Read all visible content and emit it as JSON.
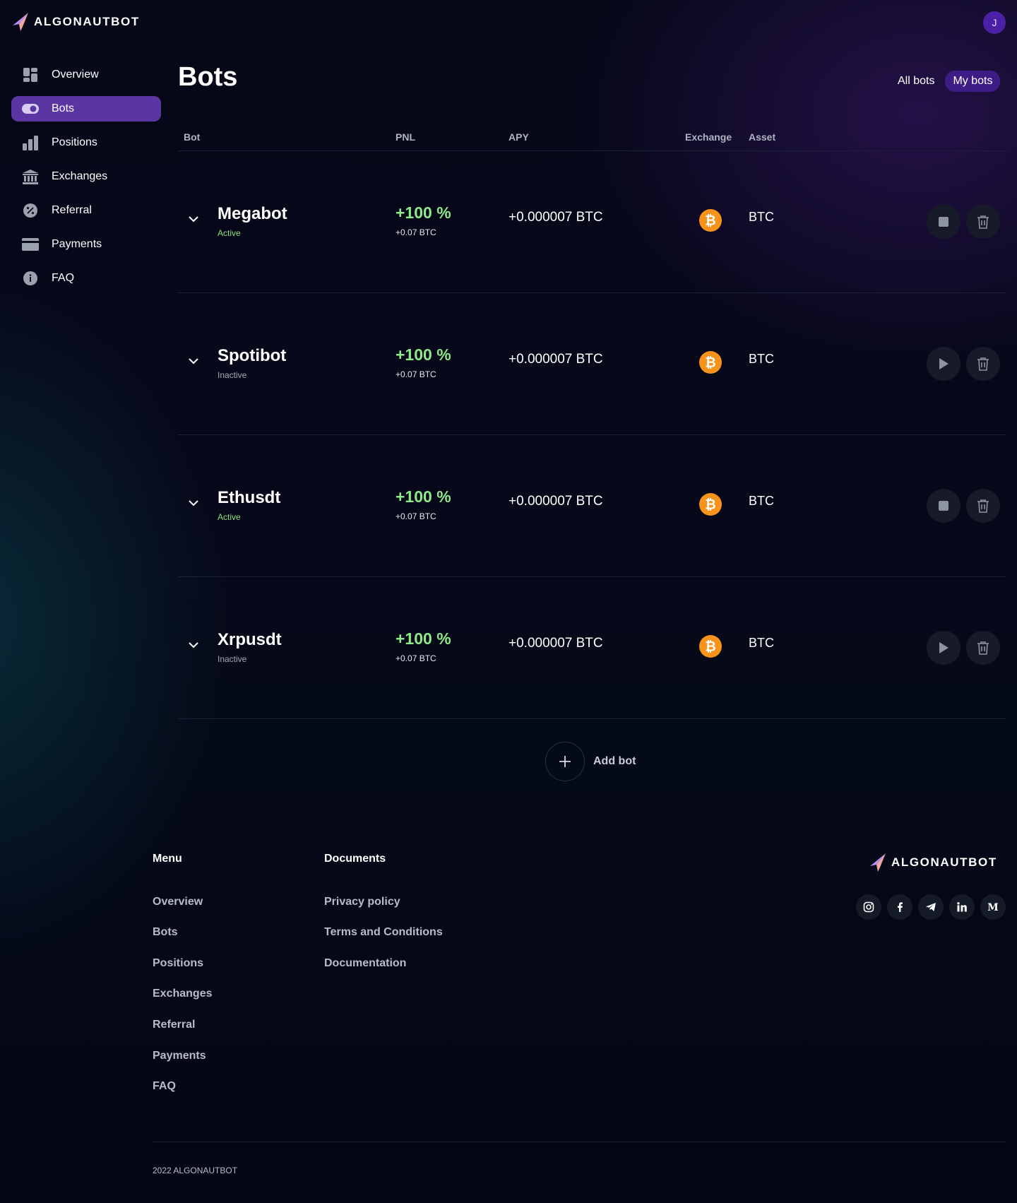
{
  "brand": {
    "name": "ALGONAUTBOT"
  },
  "user": {
    "avatar_initial": "J",
    "avatar_color": "#4b1fa6"
  },
  "colors": {
    "accent": "#5b36a3",
    "positive": "#8fe889",
    "coin": "#f7931a"
  },
  "sidebar": {
    "items": [
      {
        "label": "Overview",
        "icon": "overview-icon"
      },
      {
        "label": "Bots",
        "icon": "toggle-icon",
        "active": true
      },
      {
        "label": "Positions",
        "icon": "bar-chart-icon"
      },
      {
        "label": "Exchanges",
        "icon": "bank-icon"
      },
      {
        "label": "Referral",
        "icon": "percent-icon"
      },
      {
        "label": "Payments",
        "icon": "card-icon"
      },
      {
        "label": "FAQ",
        "icon": "info-icon"
      }
    ]
  },
  "page": {
    "title": "Bots"
  },
  "filter": {
    "all": "All bots",
    "mine": "My bots",
    "selected": "My bots"
  },
  "table": {
    "headers": {
      "bot": "Bot",
      "pnl": "PNL",
      "apy": "APY",
      "exchange": "Exchange",
      "asset": "Asset"
    },
    "rows": [
      {
        "name": "Megabot",
        "status": "Active",
        "pnl": "+100 %",
        "pnl_sub": "+0.07 BTC",
        "apy": "+0.000007 BTC",
        "exchange_icon": "bitcoin-icon",
        "asset": "BTC",
        "action": "stop"
      },
      {
        "name": "Spotibot",
        "status": "Inactive",
        "pnl": "+100 %",
        "pnl_sub": "+0.07 BTC",
        "apy": "+0.000007 BTC",
        "exchange_icon": "bitcoin-icon",
        "asset": "BTC",
        "action": "play"
      },
      {
        "name": "Ethusdt",
        "status": "Active",
        "pnl": "+100 %",
        "pnl_sub": "+0.07 BTC",
        "apy": "+0.000007 BTC",
        "exchange_icon": "bitcoin-icon",
        "asset": "BTC",
        "action": "stop"
      },
      {
        "name": "Xrpusdt",
        "status": "Inactive",
        "pnl": "+100 %",
        "pnl_sub": "+0.07 BTC",
        "apy": "+0.000007 BTC",
        "exchange_icon": "bitcoin-icon",
        "asset": "BTC",
        "action": "play"
      }
    ]
  },
  "add_bot": {
    "label": "Add bot"
  },
  "footer": {
    "menu_title": "Menu",
    "menu": [
      "Overview",
      "Bots",
      "Positions",
      "Exchanges",
      "Referral",
      "Payments",
      "FAQ"
    ],
    "documents_title": "Documents",
    "documents": [
      "Privacy policy",
      "Terms and Conditions",
      "Documentation"
    ],
    "brand": "ALGONAUTBOT",
    "socials": [
      "instagram-icon",
      "facebook-icon",
      "telegram-icon",
      "linkedin-icon",
      "medium-icon"
    ],
    "copyright": "2022 ALGONAUTBOT"
  }
}
